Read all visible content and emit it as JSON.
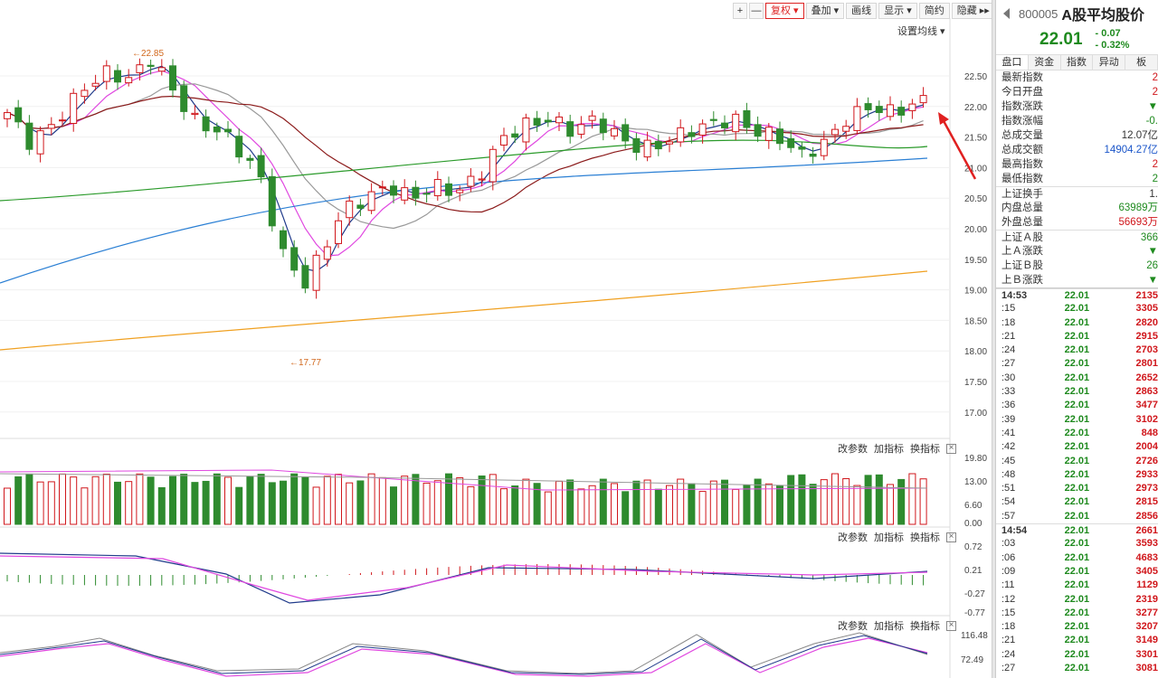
{
  "toolbar": {
    "plus": "+",
    "minus": "—",
    "buttons": [
      "复权 ▾",
      "叠加 ▾",
      "画线",
      "显示 ▾",
      "简约",
      "隐藏 ▸▸"
    ],
    "active_button": "复权 ▾",
    "ma_setting": "设置均线 ▾"
  },
  "main_chart": {
    "price_axis_labels": [
      "22.50",
      "22.00",
      "21.50",
      "21.00",
      "20.50",
      "20.00",
      "19.50",
      "19.00",
      "18.50",
      "18.00",
      "17.50",
      "17.00"
    ],
    "high_marker": "←22.85",
    "low_marker": "←17.77"
  },
  "volume_panel": {
    "tools": [
      "改参数",
      "加指标",
      "换指标"
    ],
    "axis_labels": [
      "19.80",
      "13.00",
      "6.60",
      "0.00"
    ]
  },
  "macd_panel": {
    "tools": [
      "改参数",
      "加指标",
      "换指标"
    ],
    "axis_labels": [
      "0.72",
      "0.21",
      "-0.27",
      "-0.77"
    ]
  },
  "kdj_panel": {
    "tools": [
      "改参数",
      "加指标",
      "换指标"
    ],
    "axis_labels": [
      "116.48",
      "72.49"
    ]
  },
  "quote": {
    "code": "800005",
    "name": "A股平均股价",
    "price": "22.01",
    "change": "- 0.07",
    "change_pct": "- 0.32%",
    "tabs": [
      "盘口",
      "资金",
      "指数",
      "异动",
      "板"
    ],
    "fields": [
      {
        "k": "最新指数",
        "v": "2",
        "c": "red"
      },
      {
        "k": "今日开盘",
        "v": "2",
        "c": "red"
      },
      {
        "k": "指数涨跌",
        "v": "▼",
        "c": "green"
      },
      {
        "k": "指数涨幅",
        "v": "-0.",
        "c": "green"
      },
      {
        "k": "总成交量",
        "v": "12.07亿",
        "c": "dark"
      },
      {
        "k": "总成交额",
        "v": "14904.27亿",
        "c": "blue"
      },
      {
        "k": "最高指数",
        "v": "2",
        "c": "red"
      },
      {
        "k": "最低指数",
        "v": "2",
        "c": "green"
      },
      {
        "k": "上证换手",
        "v": "1.",
        "c": "dark"
      },
      {
        "k": "内盘总量",
        "v": "63989万",
        "c": "green"
      },
      {
        "k": "外盘总量",
        "v": "56693万",
        "c": "red"
      },
      {
        "k": "上证Ａ股",
        "v": "366",
        "c": "green"
      },
      {
        "k": "上Ａ涨跌",
        "v": "▼",
        "c": "green"
      },
      {
        "k": "上证Ｂ股",
        "v": "26",
        "c": "green"
      },
      {
        "k": "上Ｂ涨跌",
        "v": "▼",
        "c": "green"
      }
    ],
    "ticks": [
      {
        "t": "14:53",
        "p": "22.01",
        "q": "2135",
        "m": true
      },
      {
        "t": ":15",
        "p": "22.01",
        "q": "3305"
      },
      {
        "t": ":18",
        "p": "22.01",
        "q": "2820"
      },
      {
        "t": ":21",
        "p": "22.01",
        "q": "2915"
      },
      {
        "t": ":24",
        "p": "22.01",
        "q": "2703"
      },
      {
        "t": ":27",
        "p": "22.01",
        "q": "2801"
      },
      {
        "t": ":30",
        "p": "22.01",
        "q": "2652"
      },
      {
        "t": ":33",
        "p": "22.01",
        "q": "2863"
      },
      {
        "t": ":36",
        "p": "22.01",
        "q": "3477"
      },
      {
        "t": ":39",
        "p": "22.01",
        "q": "3102"
      },
      {
        "t": ":41",
        "p": "22.01",
        "q": "848"
      },
      {
        "t": ":42",
        "p": "22.01",
        "q": "2004"
      },
      {
        "t": ":45",
        "p": "22.01",
        "q": "2726"
      },
      {
        "t": ":48",
        "p": "22.01",
        "q": "2933"
      },
      {
        "t": ":51",
        "p": "22.01",
        "q": "2973"
      },
      {
        "t": ":54",
        "p": "22.01",
        "q": "2815"
      },
      {
        "t": ":57",
        "p": "22.01",
        "q": "2856"
      },
      {
        "t": "14:54",
        "p": "22.01",
        "q": "2661",
        "m": true
      },
      {
        "t": ":03",
        "p": "22.01",
        "q": "3593"
      },
      {
        "t": ":06",
        "p": "22.01",
        "q": "4683"
      },
      {
        "t": ":09",
        "p": "22.01",
        "q": "3405"
      },
      {
        "t": ":11",
        "p": "22.01",
        "q": "1129"
      },
      {
        "t": ":12",
        "p": "22.01",
        "q": "2319"
      },
      {
        "t": ":15",
        "p": "22.01",
        "q": "3277"
      },
      {
        "t": ":18",
        "p": "22.01",
        "q": "3207"
      },
      {
        "t": ":21",
        "p": "22.01",
        "q": "3149"
      },
      {
        "t": ":24",
        "p": "22.01",
        "q": "3301"
      },
      {
        "t": ":27",
        "p": "22.01",
        "q": "3081"
      }
    ]
  },
  "colors": {
    "up": "#d0161b",
    "down": "#2e8b2e",
    "ma5": "#1f3a8a",
    "ma10": "#e048e0",
    "ma20": "#999999",
    "ma30": "#8b1a1a",
    "ma60": "#2a9a2a",
    "ma120": "#2a7fd4",
    "ma250": "#f0a020"
  }
}
